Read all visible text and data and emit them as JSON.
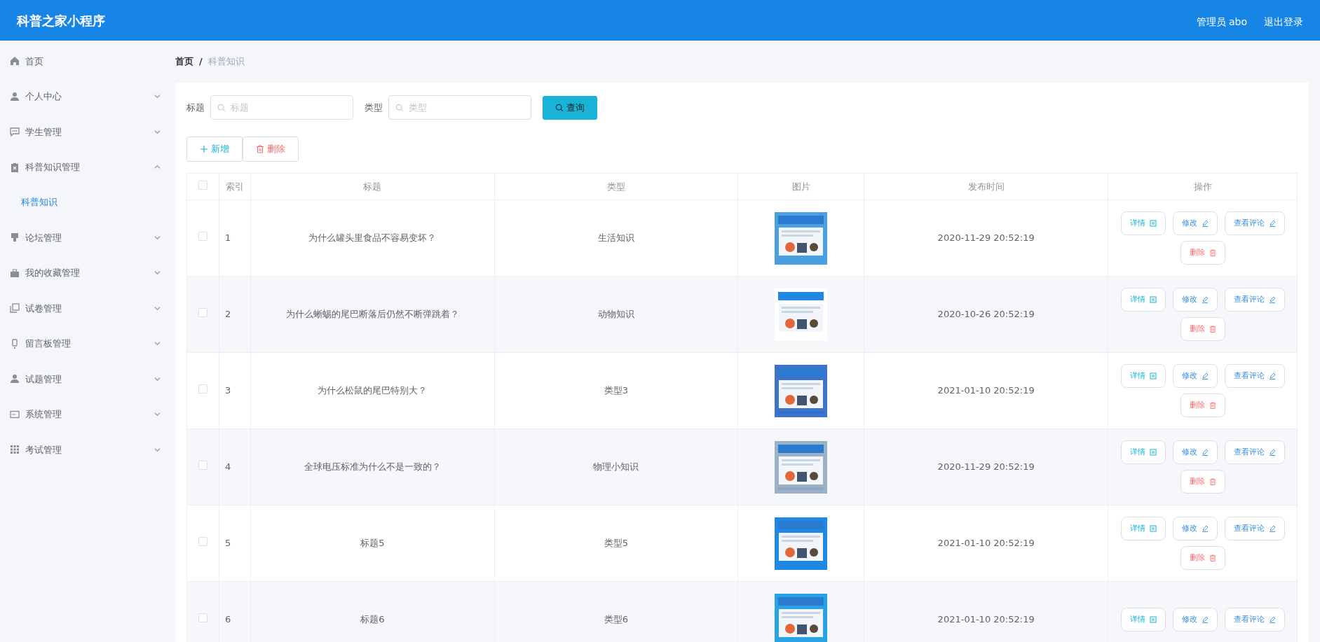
{
  "header": {
    "title": "科普之家小程序",
    "user": "管理员 abo",
    "logout": "退出登录"
  },
  "sidebar": {
    "items": [
      {
        "label": "首页",
        "kind": "link"
      },
      {
        "label": "个人中心",
        "kind": "menu",
        "expanded": false
      },
      {
        "label": "学生管理",
        "kind": "menu",
        "expanded": false
      },
      {
        "label": "科普知识管理",
        "kind": "menu",
        "expanded": true,
        "children": [
          {
            "label": "科普知识",
            "selected": true
          }
        ]
      },
      {
        "label": "论坛管理",
        "kind": "menu",
        "expanded": false
      },
      {
        "label": "我的收藏管理",
        "kind": "menu",
        "expanded": false
      },
      {
        "label": "试卷管理",
        "kind": "menu",
        "expanded": false
      },
      {
        "label": "留言板管理",
        "kind": "menu",
        "expanded": false
      },
      {
        "label": "试题管理",
        "kind": "menu",
        "expanded": false
      },
      {
        "label": "系统管理",
        "kind": "menu",
        "expanded": false
      },
      {
        "label": "考试管理",
        "kind": "menu",
        "expanded": false
      }
    ]
  },
  "breadcrumb": {
    "items": [
      "首页",
      "科普知识"
    ],
    "separator": "/"
  },
  "search": {
    "fields": [
      {
        "label": "标题",
        "placeholder": "标题"
      },
      {
        "label": "类型",
        "placeholder": "类型"
      }
    ],
    "button": "查询"
  },
  "toolbar": [
    {
      "label": "新增",
      "kind": "add"
    },
    {
      "label": "删除",
      "kind": "delete"
    }
  ],
  "table": {
    "select_all": false,
    "columns": [
      "",
      "索引",
      "标题",
      "类型",
      "图片",
      "发布时间",
      "操作"
    ],
    "rows": [
      {
        "checked": false,
        "index": "1",
        "title": "为什么罐头里食品不容易变坏？",
        "type": "生活知识",
        "image": {
          "kind": "picture"
        },
        "time": "2020-11-29 20:52:19",
        "actions": [
          {
            "label": "详情",
            "kind": "detail"
          },
          {
            "label": "修改",
            "kind": "edit"
          },
          {
            "label": "查看评论",
            "kind": "comments"
          },
          {
            "label": "删除",
            "kind": "delete"
          }
        ]
      },
      {
        "checked": false,
        "index": "2",
        "title": "为什么蜥蜴的尾巴断落后仍然不断弹跳着？",
        "type": "动物知识",
        "image": {
          "kind": "picture"
        },
        "time": "2020-10-26 20:52:19",
        "actions": [
          {
            "label": "详情",
            "kind": "detail"
          },
          {
            "label": "修改",
            "kind": "edit"
          },
          {
            "label": "查看评论",
            "kind": "comments"
          },
          {
            "label": "删除",
            "kind": "delete"
          }
        ]
      },
      {
        "checked": false,
        "index": "3",
        "title": "为什么松鼠的尾巴特别大？",
        "type": "类型3",
        "image": {
          "kind": "picture"
        },
        "time": "2021-01-10 20:52:19",
        "actions": [
          {
            "label": "详情",
            "kind": "detail"
          },
          {
            "label": "修改",
            "kind": "edit"
          },
          {
            "label": "查看评论",
            "kind": "comments"
          },
          {
            "label": "删除",
            "kind": "delete"
          }
        ]
      },
      {
        "checked": false,
        "index": "4",
        "title": "全球电压标准为什么不是一致的？",
        "type": "物理小知识",
        "image": {
          "kind": "picture"
        },
        "time": "2020-11-29 20:52:19",
        "actions": [
          {
            "label": "详情",
            "kind": "detail"
          },
          {
            "label": "修改",
            "kind": "edit"
          },
          {
            "label": "查看评论",
            "kind": "comments"
          },
          {
            "label": "删除",
            "kind": "delete"
          }
        ]
      },
      {
        "checked": false,
        "index": "5",
        "title": "标题5",
        "type": "类型5",
        "image": {
          "kind": "picture"
        },
        "time": "2021-01-10 20:52:19",
        "actions": [
          {
            "label": "详情",
            "kind": "detail"
          },
          {
            "label": "修改",
            "kind": "edit"
          },
          {
            "label": "查看评论",
            "kind": "comments"
          },
          {
            "label": "删除",
            "kind": "delete"
          }
        ]
      },
      {
        "checked": false,
        "index": "6",
        "title": "标题6",
        "type": "类型6",
        "image": {
          "kind": "picture"
        },
        "time": "2021-01-10 20:52:19",
        "actions": [
          {
            "label": "详情",
            "kind": "detail"
          },
          {
            "label": "修改",
            "kind": "edit"
          },
          {
            "label": "查看评论",
            "kind": "comments"
          }
        ]
      }
    ]
  }
}
